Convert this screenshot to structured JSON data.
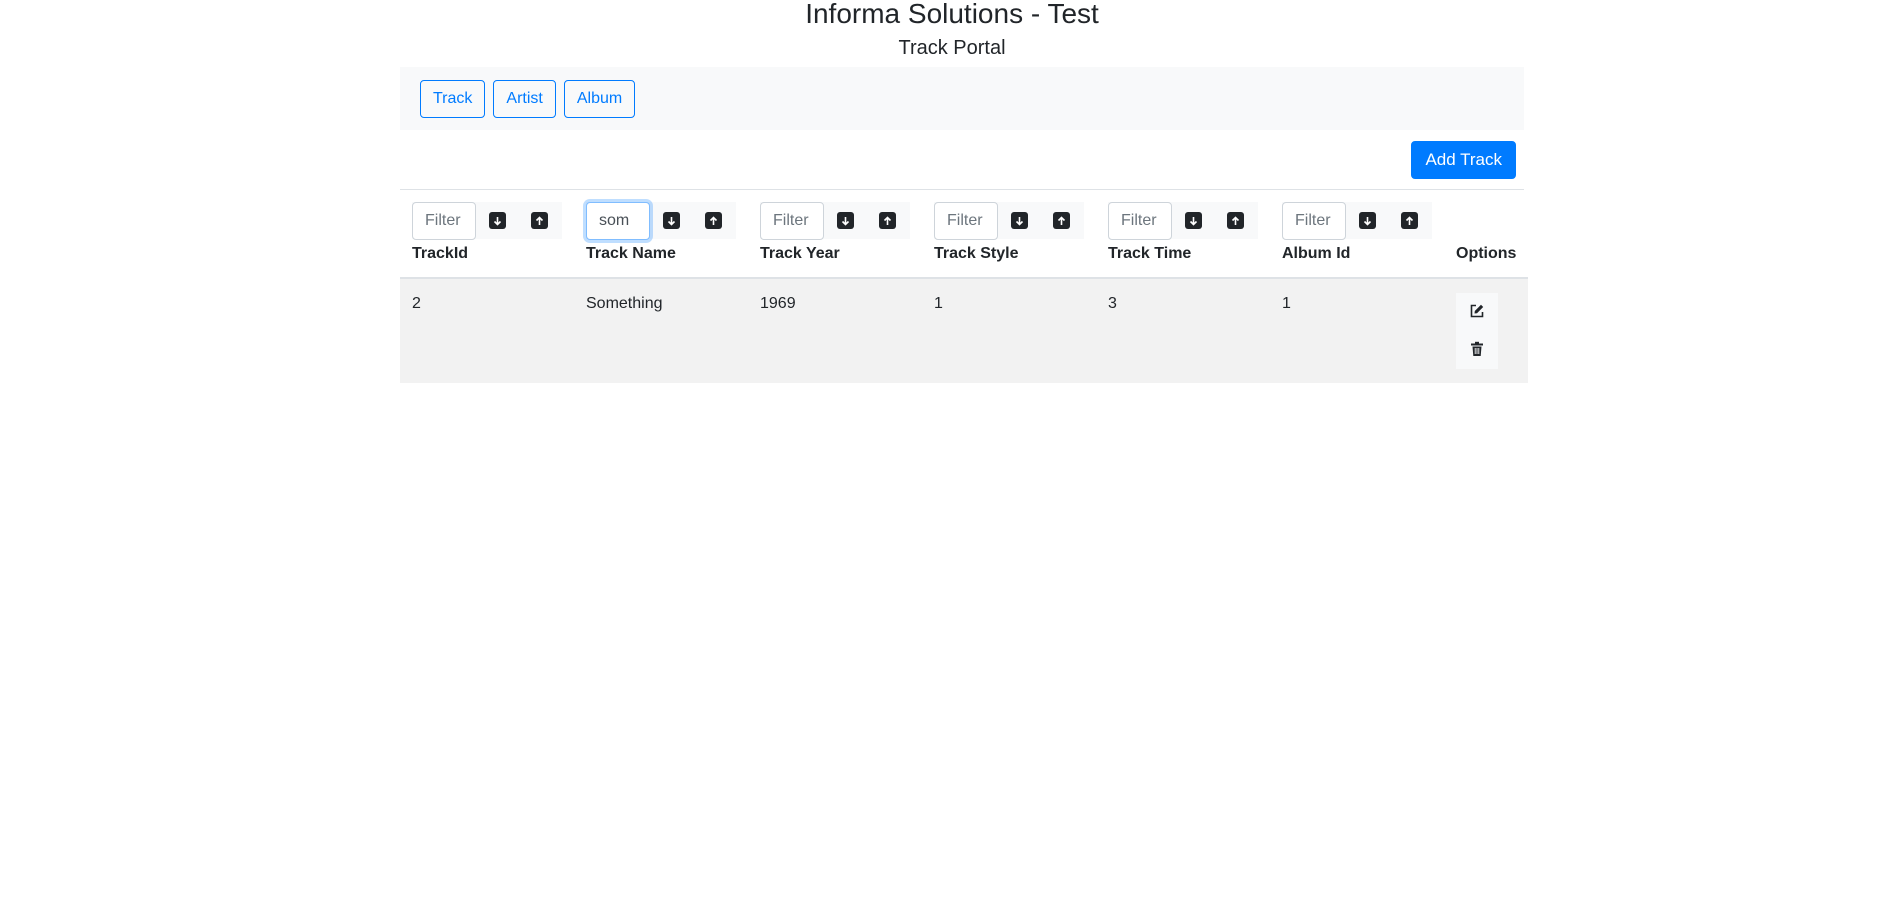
{
  "header": {
    "title": "Informa Solutions - Test",
    "subtitle": "Track Portal"
  },
  "nav": {
    "items": [
      {
        "label": "Track"
      },
      {
        "label": "Artist"
      },
      {
        "label": "Album"
      }
    ]
  },
  "toolbar": {
    "add_label": "Add Track"
  },
  "table": {
    "filter_placeholder": "Filter",
    "columns": [
      {
        "label": "TrackId",
        "filter_value": ""
      },
      {
        "label": "Track Name",
        "filter_value": "som"
      },
      {
        "label": "Track Year",
        "filter_value": ""
      },
      {
        "label": "Track Style",
        "filter_value": ""
      },
      {
        "label": "Track Time",
        "filter_value": ""
      },
      {
        "label": "Album Id",
        "filter_value": ""
      },
      {
        "label": "Options"
      }
    ],
    "rows": [
      {
        "cells": [
          "2",
          "Something",
          "1969",
          "1",
          "3",
          "1"
        ]
      }
    ]
  },
  "icons": {
    "sort_desc": "arrow-down-icon",
    "sort_asc": "arrow-up-icon",
    "edit": "edit-icon",
    "delete": "trash-icon"
  },
  "colors": {
    "primary": "#007bff",
    "row_background": "#f2f2f2",
    "nav_background": "#f8f9fa"
  }
}
